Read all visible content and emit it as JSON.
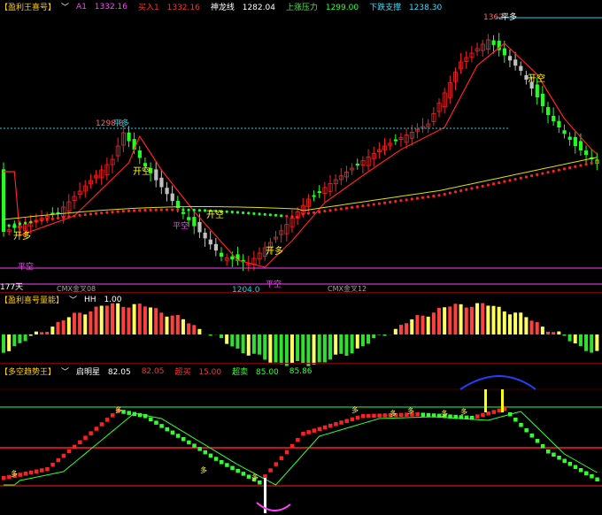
{
  "panel1": {
    "title": "【盈利王喜号】",
    "indicators": [
      {
        "label": "A1",
        "value": "1332.16",
        "color": "#ff40ff"
      },
      {
        "label": "买入1",
        "value": "1332.16",
        "color": "#ff3030"
      },
      {
        "label": "神龙线",
        "value": "1282.04",
        "color": "#ffffff"
      },
      {
        "label": "上涨压力",
        "value": "1299.00",
        "color": "#30ff30"
      },
      {
        "label": "下跌支撑",
        "value": "1238.30",
        "color": "#30e0ff"
      }
    ],
    "labels": {
      "high1": "1298.8",
      "high1_tag": "平多",
      "high2": "1362",
      "high2_tag": "平多",
      "low": "1204.0",
      "low_tag": "平空",
      "kai_kong_1": "开空",
      "kai_kong_2": "开空",
      "kai_kong_3": "开空",
      "kai_duo_1": "开多",
      "kai_duo_2": "开多",
      "ping_kong_1": "平空",
      "ping_kong_2": "平空",
      "days": "177天",
      "marker_1": "CMX金叉08",
      "marker_2": "CMX金叉12"
    }
  },
  "panel2": {
    "title": "【盈利喜号量能】",
    "indicators": [
      {
        "label": "HH",
        "value": "1.00",
        "color": "#ffffff"
      }
    ]
  },
  "panel3": {
    "title": "【多空趋势王】",
    "indicators": [
      {
        "label": "启明星",
        "value": "82.05",
        "color": "#ffffff"
      },
      {
        "label": "",
        "value": "82.05",
        "color": "#ff3030"
      },
      {
        "label": "超买",
        "value": "15.00",
        "color": "#ff3030"
      },
      {
        "label": "超卖",
        "value": "85.00",
        "color": "#30ff30"
      },
      {
        "label": "",
        "value": "85.86",
        "color": "#30ff30"
      }
    ],
    "marks": {
      "duo": "多"
    }
  },
  "colors": {
    "up": "#ff2020",
    "down": "#20ff20",
    "neutral": "#c0c0c0",
    "yellow_line": "#e0e000",
    "cyan": "#20d0e0",
    "magenta": "#ff40ff",
    "panel_sep": "#7a0000"
  }
}
